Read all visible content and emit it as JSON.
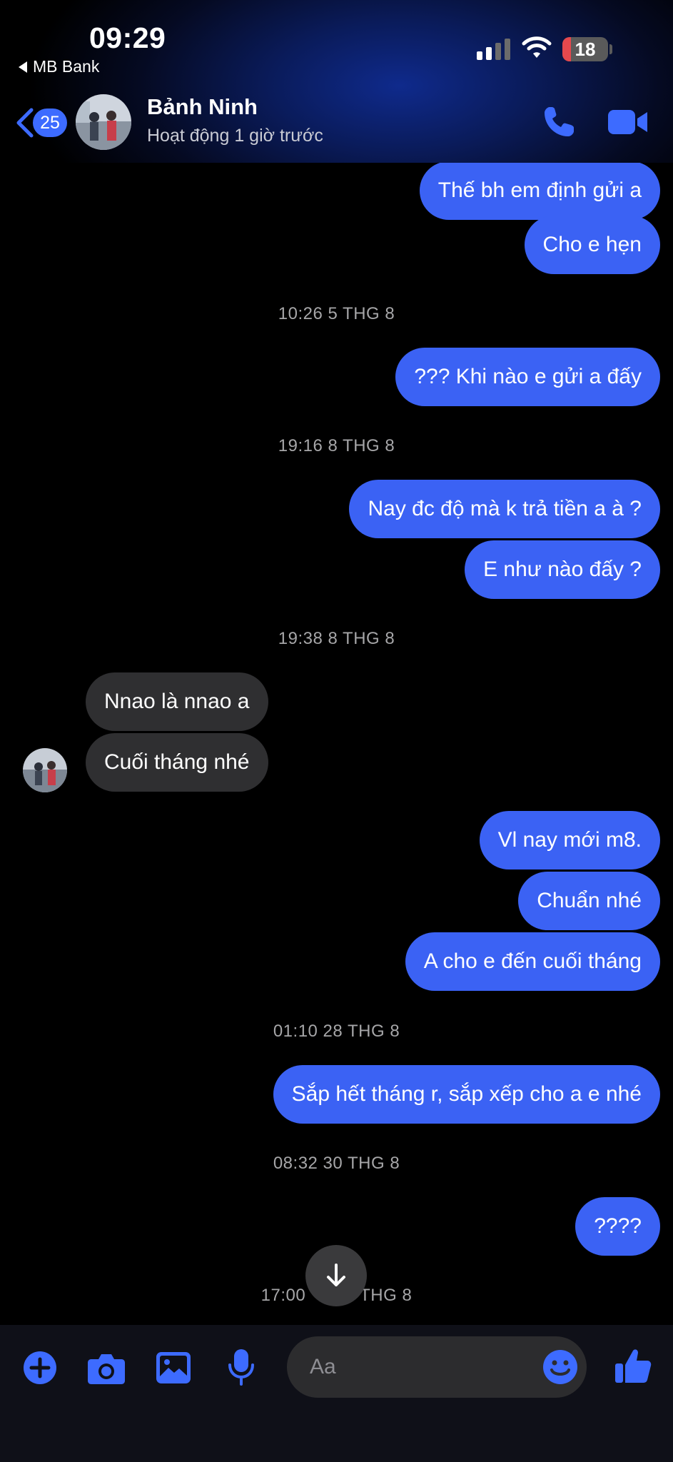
{
  "status_bar": {
    "time": "09:29",
    "back_app": "MB Bank",
    "battery": "18",
    "battery_level": 0.18
  },
  "header": {
    "unread_count": "25",
    "contact_name": "Bảnh Ninh",
    "contact_status": "Hoạt động 1 giờ trước"
  },
  "messages": {
    "m1": "Thế bh em định gửi a",
    "m2": "Cho e hẹn",
    "ts1": "10:26 5 THG 8",
    "m3": "??? Khi nào e gửi a đấy",
    "ts2": "19:16 8 THG 8",
    "m4": "Nay đc độ mà k trả tiền a à ?",
    "m5": "E như nào đấy ?",
    "ts3": "19:38 8 THG 8",
    "m6": "Nnao là nnao a",
    "m7": "Cuối tháng nhé",
    "m8": "Vl nay mới m8.",
    "m9": "Chuẩn nhé",
    "m10": "A cho e đến cuối tháng",
    "ts4": "01:10 28 THG 8",
    "m11": "Sắp hết tháng r, sắp xếp cho a e nhé",
    "ts5": "08:32 30 THG 8",
    "m12": "????",
    "ts6_left": "17:00",
    "ts6_right": "THG 8"
  },
  "composer": {
    "placeholder": "Aa"
  },
  "colors": {
    "accent": "#3b62f4",
    "incoming_bubble": "#2f2f31",
    "background": "#000000"
  },
  "icons": [
    "back-chevron-icon",
    "phone-icon",
    "video-camera-icon",
    "plus-icon",
    "camera-icon",
    "image-icon",
    "microphone-icon",
    "emoji-icon",
    "thumbs-up-icon",
    "arrow-down-icon"
  ]
}
